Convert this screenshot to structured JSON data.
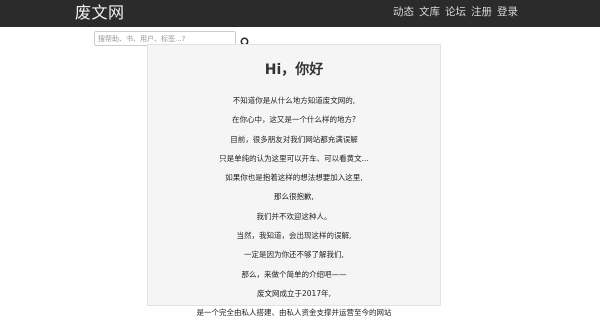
{
  "header": {
    "brand": "废文网",
    "nav": [
      "动态",
      "文库",
      "论坛",
      "注册",
      "登录"
    ]
  },
  "search": {
    "placeholder": "搜帮助、书、用户、标签...?",
    "icon": "search-icon"
  },
  "card": {
    "title": "Hi，你好",
    "lines": [
      "不知道你是从什么地方知道废文网的,",
      "在你心中，这又是一个什么样的地方?",
      "目前，很多朋友对我们网站都充满误解",
      "只是单纯的认为这里可以开车、可以看黄文...",
      "如果你也是抱着这样的想法想要加入这里,",
      "那么很抱歉,",
      "我们并不欢迎这种人。",
      "当然，我知道，会出现这样的误解,",
      "一定是因为你还不够了解我们,",
      "那么，来做个简单的介绍吧——",
      "废文网成立于2017年,",
      "是一个完全由私人搭建、由私人资金支撑并运营至今的网站"
    ]
  },
  "colors": {
    "navbar_bg": "#2b2b2b",
    "card_bg": "#f5f5f5"
  }
}
